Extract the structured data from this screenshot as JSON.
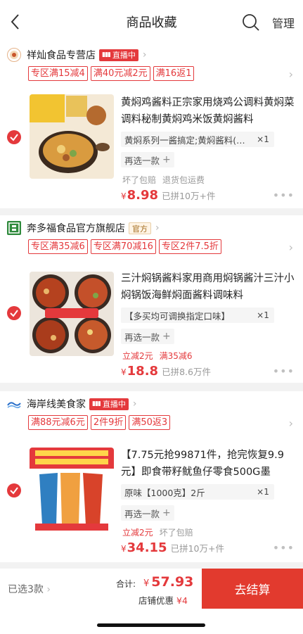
{
  "header": {
    "title": "商品收藏",
    "manage_label": "管理"
  },
  "stores": [
    {
      "name": "祥灿食品专营店",
      "badge": "直播中",
      "promos": [
        "专区满15减4",
        "满40元减2元",
        "满16返1"
      ],
      "product": {
        "title": "黄焖鸡酱料正宗家用烧鸡公调料黄焖菜调料秘制黄焖鸡米饭黄焖酱料",
        "spec": "黄焖系列一酱搞定;黄焖酱料(…",
        "qty": "×1",
        "reselect": "再选一款",
        "tags": [
          "坏了包赔",
          "退货包运费"
        ],
        "currency": "¥",
        "price": "8.98",
        "sold": "已拼10万+件"
      }
    },
    {
      "name": "奔多福食品官方旗舰店",
      "badge": "官方",
      "promos": [
        "专区满35减6",
        "专区满70减16",
        "专区2件7.5折"
      ],
      "product": {
        "title": "三汁焖锅酱料家用商用焖锅酱汁三汁小焖锅饭海鲜焖面酱料调味料",
        "spec": "【多买均可调换指定口味】",
        "qty": "×1",
        "reselect": "再选一款",
        "tags": [
          "立减2元",
          "满35减6"
        ],
        "currency": "¥",
        "price": "18.8",
        "sold": "已拼8.6万件"
      }
    },
    {
      "name": "海岸线美食家",
      "badge": "直播中",
      "promos": [
        "满88元减6元",
        "2件9折",
        "满50返3"
      ],
      "product": {
        "title": "【7.75元抢99871件，抢完恢复9.9元】即食带籽鱿鱼仔零食500G墨",
        "spec": "原味【1000克】2斤",
        "qty": "×1",
        "reselect": "再选一款",
        "tags": [
          "立减2元",
          "坏了包赔"
        ],
        "currency": "¥",
        "price": "34.15",
        "sold": "已拼10万+件"
      }
    }
  ],
  "footer": {
    "selected_label": "已选3款",
    "total_label": "合计:",
    "currency": "¥",
    "total_value": "57.93",
    "discount_label": "店铺优惠",
    "discount_value": "¥4",
    "checkout_label": "去结算"
  },
  "colors": {
    "accent": "#e4393c",
    "checkout_bg": "#e23a2e"
  }
}
